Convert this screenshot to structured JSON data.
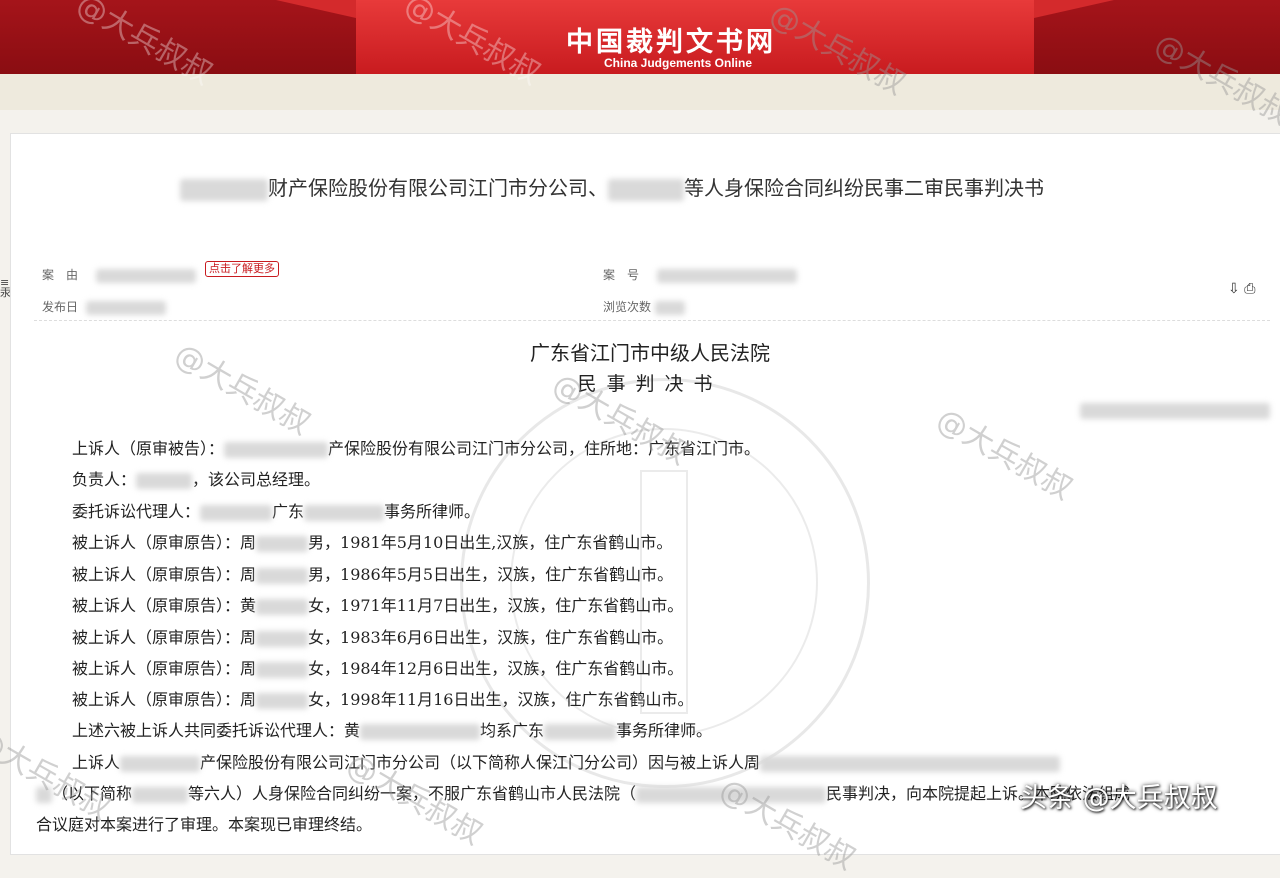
{
  "header": {
    "site_name": "中国裁判文书网",
    "site_name_en": "China Judgements Online"
  },
  "document": {
    "title_mid": "财产保险股份有限公司江门市分公司、",
    "title_end": "等人身保险合同纠纷民事二审民事判决书",
    "meta": {
      "cause_label": "案　由",
      "learn_more": "点击了解更多",
      "case_no_label": "案　号",
      "publish_label": "发布日",
      "views_label": "浏览次数"
    },
    "court": "广东省江门市中级人民法院",
    "doc_type": "民事判决书",
    "lines": [
      {
        "pre": "上诉人（原审被告）：",
        "post": "产保险股份有限公司江门市分公司，住所地：广东省江门市。"
      },
      {
        "pre": "负责人：",
        "post": "，该公司总经理。"
      },
      {
        "pre": "委托诉讼代理人：",
        "mid": "广东",
        "post": "事务所律师。"
      },
      {
        "pre": "被上诉人（原审原告）：周",
        "post": "男，1981年5月10日出生,汉族，住广东省鹤山市。"
      },
      {
        "pre": "被上诉人（原审原告）：周",
        "post": "男，1986年5月5日出生，汉族，住广东省鹤山市。"
      },
      {
        "pre": "被上诉人（原审原告）：黄",
        "post": "女，1971年11月7日出生，汉族，住广东省鹤山市。"
      },
      {
        "pre": "被上诉人（原审原告）：周",
        "post": "女，1983年6月6日出生，汉族，住广东省鹤山市。"
      },
      {
        "pre": "被上诉人（原审原告）：周",
        "post": "女，1984年12月6日出生，汉族，住广东省鹤山市。"
      },
      {
        "pre": "被上诉人（原审原告）：周",
        "post": "女，1998年11月16日出生，汉族，住广东省鹤山市。"
      },
      {
        "pre": "上述六被上诉人共同委托诉讼代理人：黄",
        "mid": "均系广东",
        "post": "事务所律师。"
      },
      {
        "pre": "上诉人",
        "post": "产保险股份有限公司江门市分公司（以下简称人保江门分公司）因与被上诉人周"
      },
      {
        "pre": "（以下简称",
        "mid": "等六人）人身保险合同纠纷一案，不服广东省鹤山市人民法院（",
        "post": "民事判决，向本院提起上诉。本院依法组成"
      },
      {
        "pre": "合议庭对本案进行了审理。本案现已审理终结。",
        "post": ""
      }
    ]
  },
  "watermarks": {
    "text": "@大兵叔叔",
    "footer": "头条 @大兵叔叔"
  },
  "icons": [
    "download-icon",
    "print-icon",
    "side-menu-icon"
  ]
}
